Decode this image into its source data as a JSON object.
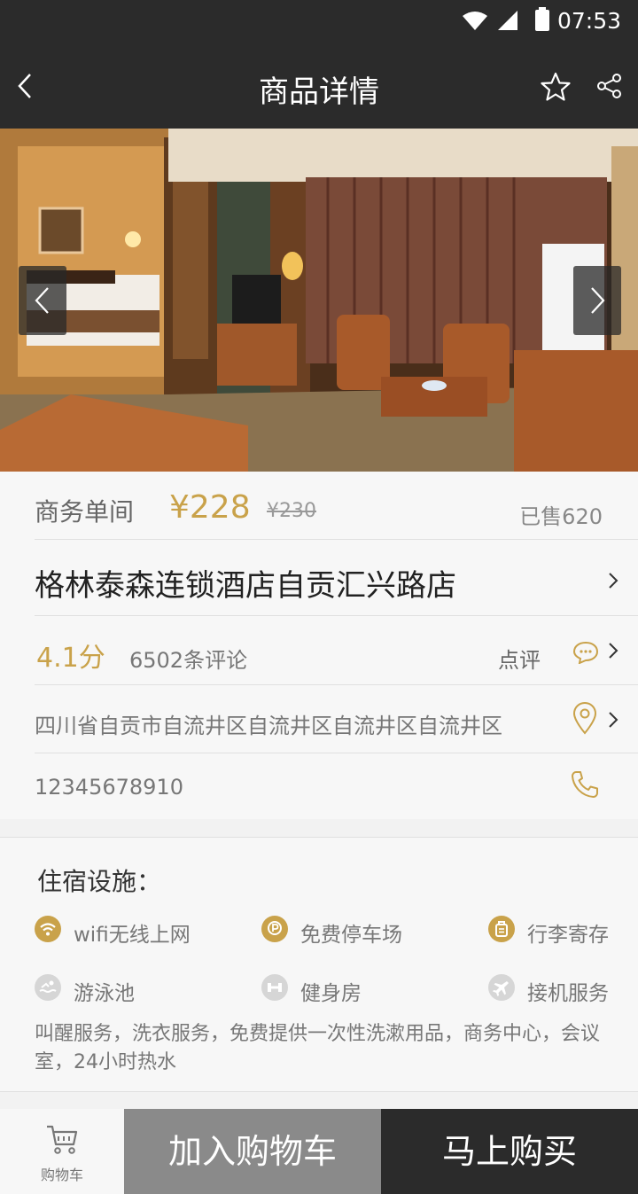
{
  "status_bar": {
    "time": "07:53",
    "icons": [
      "wifi-icon",
      "signal-icon",
      "battery-icon"
    ]
  },
  "nav": {
    "title": "商品详情",
    "back_icon": "chevron-left-icon",
    "favorite_icon": "star-icon",
    "share_icon": "share-icon"
  },
  "gallery": {
    "prev_icon": "chevron-left-icon",
    "next_icon": "chevron-right-icon"
  },
  "product": {
    "room_type": "商务单间",
    "price": "¥228",
    "original_price": "¥230",
    "sold": "已售620"
  },
  "hotel": {
    "name": "格林泰森连锁酒店自贡汇兴路店",
    "score": "4.1分",
    "review_count": "6502条评论",
    "comment_label": "点评",
    "address": "四川省自贡市自流井区自流井区自流井区自流井区",
    "phone": "12345678910"
  },
  "facilities": {
    "title": "住宿设施：",
    "items": [
      {
        "label": "wifi无线上网",
        "icon": "wifi-icon",
        "available": true
      },
      {
        "label": "免费停车场",
        "icon": "parking-icon",
        "available": true
      },
      {
        "label": "行李寄存",
        "icon": "luggage-icon",
        "available": true
      },
      {
        "label": "游泳池",
        "icon": "swimming-icon",
        "available": false
      },
      {
        "label": "健身房",
        "icon": "dumbbell-icon",
        "available": false
      },
      {
        "label": "接机服务",
        "icon": "airplane-icon",
        "available": false
      }
    ],
    "note": "叫醒服务，洗衣服务，免费提供一次性洗漱用品，商务中心，会议室，24小时热水"
  },
  "bottom_bar": {
    "cart_label": "购物车",
    "add_to_cart": "加入购物车",
    "buy_now": "马上购买"
  },
  "colors": {
    "accent": "#c9a24a",
    "dark_bar": "#2b2b2b",
    "gray_button": "#8a8a8a",
    "inactive_icon": "#d6d6d6"
  }
}
